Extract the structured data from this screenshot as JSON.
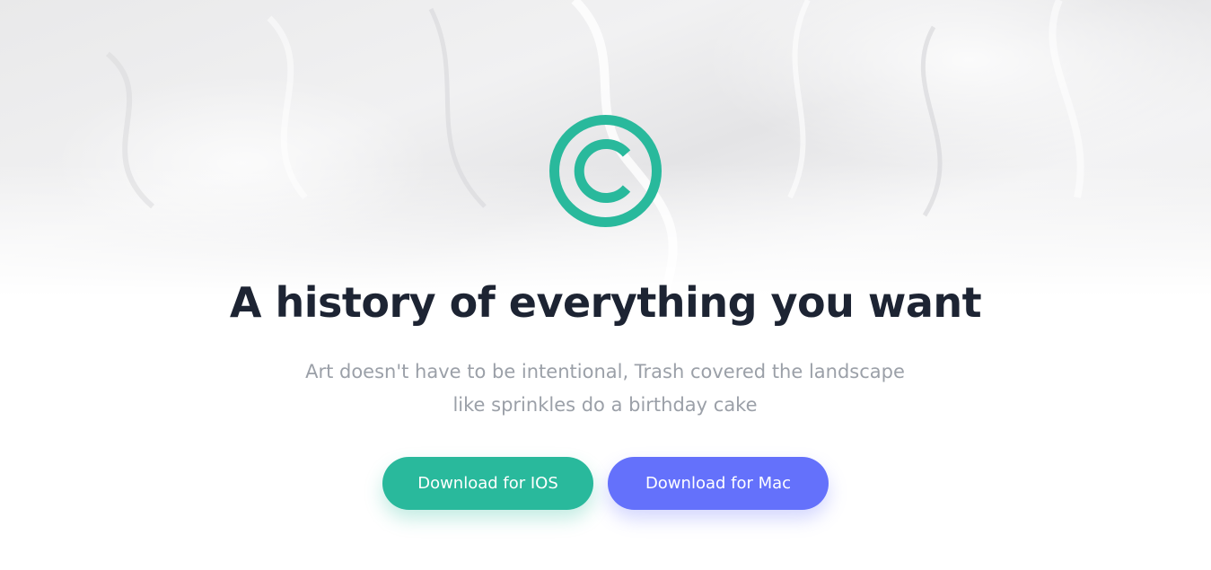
{
  "colors": {
    "accent_green": "#29b99c",
    "accent_blue": "#6471fb",
    "title_text": "#1d2433",
    "subtitle_text": "#9ba0a8"
  },
  "logo": {
    "icon": "copyright-icon"
  },
  "hero": {
    "title": "A history of everything you want",
    "subtitle_line1": "Art doesn't have to be intentional, Trash covered the landscape",
    "subtitle_line2": "like sprinkles do a birthday cake"
  },
  "buttons": {
    "ios_label": "Download for IOS",
    "mac_label": "Download for Mac"
  }
}
